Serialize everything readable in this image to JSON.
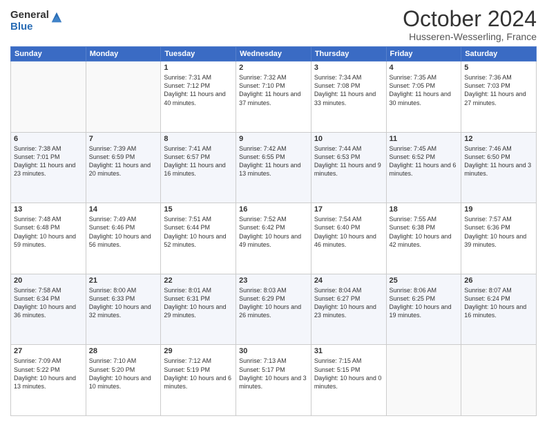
{
  "header": {
    "logo_general": "General",
    "logo_blue": "Blue",
    "month_title": "October 2024",
    "location": "Husseren-Wesserling, France"
  },
  "days_of_week": [
    "Sunday",
    "Monday",
    "Tuesday",
    "Wednesday",
    "Thursday",
    "Friday",
    "Saturday"
  ],
  "weeks": [
    [
      {
        "day": "",
        "info": ""
      },
      {
        "day": "",
        "info": ""
      },
      {
        "day": "1",
        "info": "Sunrise: 7:31 AM\nSunset: 7:12 PM\nDaylight: 11 hours and 40 minutes."
      },
      {
        "day": "2",
        "info": "Sunrise: 7:32 AM\nSunset: 7:10 PM\nDaylight: 11 hours and 37 minutes."
      },
      {
        "day": "3",
        "info": "Sunrise: 7:34 AM\nSunset: 7:08 PM\nDaylight: 11 hours and 33 minutes."
      },
      {
        "day": "4",
        "info": "Sunrise: 7:35 AM\nSunset: 7:05 PM\nDaylight: 11 hours and 30 minutes."
      },
      {
        "day": "5",
        "info": "Sunrise: 7:36 AM\nSunset: 7:03 PM\nDaylight: 11 hours and 27 minutes."
      }
    ],
    [
      {
        "day": "6",
        "info": "Sunrise: 7:38 AM\nSunset: 7:01 PM\nDaylight: 11 hours and 23 minutes."
      },
      {
        "day": "7",
        "info": "Sunrise: 7:39 AM\nSunset: 6:59 PM\nDaylight: 11 hours and 20 minutes."
      },
      {
        "day": "8",
        "info": "Sunrise: 7:41 AM\nSunset: 6:57 PM\nDaylight: 11 hours and 16 minutes."
      },
      {
        "day": "9",
        "info": "Sunrise: 7:42 AM\nSunset: 6:55 PM\nDaylight: 11 hours and 13 minutes."
      },
      {
        "day": "10",
        "info": "Sunrise: 7:44 AM\nSunset: 6:53 PM\nDaylight: 11 hours and 9 minutes."
      },
      {
        "day": "11",
        "info": "Sunrise: 7:45 AM\nSunset: 6:52 PM\nDaylight: 11 hours and 6 minutes."
      },
      {
        "day": "12",
        "info": "Sunrise: 7:46 AM\nSunset: 6:50 PM\nDaylight: 11 hours and 3 minutes."
      }
    ],
    [
      {
        "day": "13",
        "info": "Sunrise: 7:48 AM\nSunset: 6:48 PM\nDaylight: 10 hours and 59 minutes."
      },
      {
        "day": "14",
        "info": "Sunrise: 7:49 AM\nSunset: 6:46 PM\nDaylight: 10 hours and 56 minutes."
      },
      {
        "day": "15",
        "info": "Sunrise: 7:51 AM\nSunset: 6:44 PM\nDaylight: 10 hours and 52 minutes."
      },
      {
        "day": "16",
        "info": "Sunrise: 7:52 AM\nSunset: 6:42 PM\nDaylight: 10 hours and 49 minutes."
      },
      {
        "day": "17",
        "info": "Sunrise: 7:54 AM\nSunset: 6:40 PM\nDaylight: 10 hours and 46 minutes."
      },
      {
        "day": "18",
        "info": "Sunrise: 7:55 AM\nSunset: 6:38 PM\nDaylight: 10 hours and 42 minutes."
      },
      {
        "day": "19",
        "info": "Sunrise: 7:57 AM\nSunset: 6:36 PM\nDaylight: 10 hours and 39 minutes."
      }
    ],
    [
      {
        "day": "20",
        "info": "Sunrise: 7:58 AM\nSunset: 6:34 PM\nDaylight: 10 hours and 36 minutes."
      },
      {
        "day": "21",
        "info": "Sunrise: 8:00 AM\nSunset: 6:33 PM\nDaylight: 10 hours and 32 minutes."
      },
      {
        "day": "22",
        "info": "Sunrise: 8:01 AM\nSunset: 6:31 PM\nDaylight: 10 hours and 29 minutes."
      },
      {
        "day": "23",
        "info": "Sunrise: 8:03 AM\nSunset: 6:29 PM\nDaylight: 10 hours and 26 minutes."
      },
      {
        "day": "24",
        "info": "Sunrise: 8:04 AM\nSunset: 6:27 PM\nDaylight: 10 hours and 23 minutes."
      },
      {
        "day": "25",
        "info": "Sunrise: 8:06 AM\nSunset: 6:25 PM\nDaylight: 10 hours and 19 minutes."
      },
      {
        "day": "26",
        "info": "Sunrise: 8:07 AM\nSunset: 6:24 PM\nDaylight: 10 hours and 16 minutes."
      }
    ],
    [
      {
        "day": "27",
        "info": "Sunrise: 7:09 AM\nSunset: 5:22 PM\nDaylight: 10 hours and 13 minutes."
      },
      {
        "day": "28",
        "info": "Sunrise: 7:10 AM\nSunset: 5:20 PM\nDaylight: 10 hours and 10 minutes."
      },
      {
        "day": "29",
        "info": "Sunrise: 7:12 AM\nSunset: 5:19 PM\nDaylight: 10 hours and 6 minutes."
      },
      {
        "day": "30",
        "info": "Sunrise: 7:13 AM\nSunset: 5:17 PM\nDaylight: 10 hours and 3 minutes."
      },
      {
        "day": "31",
        "info": "Sunrise: 7:15 AM\nSunset: 5:15 PM\nDaylight: 10 hours and 0 minutes."
      },
      {
        "day": "",
        "info": ""
      },
      {
        "day": "",
        "info": ""
      }
    ]
  ]
}
